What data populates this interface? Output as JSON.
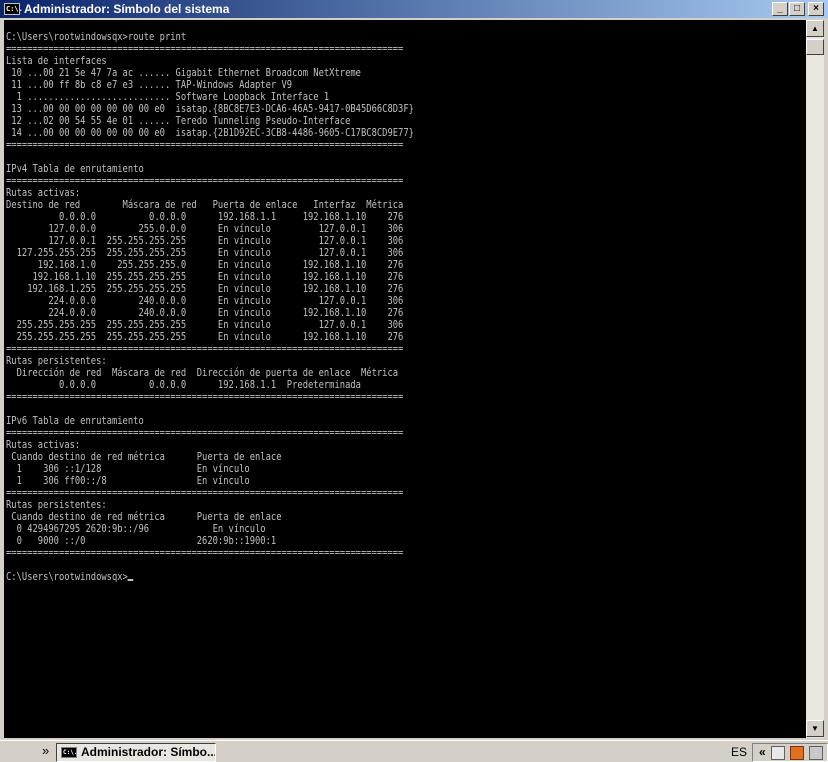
{
  "window": {
    "title": "Administrador: Símbolo del sistema",
    "icon_label": "C:\\."
  },
  "console": {
    "lines": [
      "C:\\Users\\rootwindowsqx>route print",
      "===========================================================================",
      "Lista de interfaces",
      " 10 ...00 21 5e 47 7a ac ...... Gigabit Ethernet Broadcom NetXtreme",
      " 11 ...00 ff 8b c8 e7 e3 ...... TAP-Windows Adapter V9",
      "  1 ........................... Software Loopback Interface 1",
      " 13 ...00 00 00 00 00 00 00 e0  isatap.{8BC8E7E3-DCA6-46A5-9417-0B45D66C8D3F}",
      " 12 ...02 00 54 55 4e 01 ...... Teredo Tunneling Pseudo-Interface",
      " 14 ...00 00 00 00 00 00 00 e0  isatap.{2B1D92EC-3CB8-4486-9605-C17BC8CD9E77}",
      "===========================================================================",
      "",
      "IPv4 Tabla de enrutamiento",
      "===========================================================================",
      "Rutas activas:",
      "Destino de red        Máscara de red   Puerta de enlace   Interfaz  Métrica",
      "          0.0.0.0          0.0.0.0      192.168.1.1     192.168.1.10    276",
      "        127.0.0.0        255.0.0.0      En vínculo         127.0.0.1    306",
      "        127.0.0.1  255.255.255.255      En vínculo         127.0.0.1    306",
      "  127.255.255.255  255.255.255.255      En vínculo         127.0.0.1    306",
      "      192.168.1.0    255.255.255.0      En vínculo      192.168.1.10    276",
      "     192.168.1.10  255.255.255.255      En vínculo      192.168.1.10    276",
      "    192.168.1.255  255.255.255.255      En vínculo      192.168.1.10    276",
      "        224.0.0.0        240.0.0.0      En vínculo         127.0.0.1    306",
      "        224.0.0.0        240.0.0.0      En vínculo      192.168.1.10    276",
      "  255.255.255.255  255.255.255.255      En vínculo         127.0.0.1    306",
      "  255.255.255.255  255.255.255.255      En vínculo      192.168.1.10    276",
      "===========================================================================",
      "Rutas persistentes:",
      "  Dirección de red  Máscara de red  Dirección de puerta de enlace  Métrica",
      "          0.0.0.0          0.0.0.0      192.168.1.1  Predeterminada",
      "===========================================================================",
      "",
      "IPv6 Tabla de enrutamiento",
      "===========================================================================",
      "Rutas activas:",
      " Cuando destino de red métrica      Puerta de enlace",
      "  1    306 ::1/128                  En vínculo",
      "  1    306 ff00::/8                 En vínculo",
      "===========================================================================",
      "Rutas persistentes:",
      " Cuando destino de red métrica      Puerta de enlace",
      "  0 4294967295 2620:9b::/96            En vínculo",
      "  0   9000 ::/0                     2620:9b::1900:1",
      "===========================================================================",
      "",
      "C:\\Users\\rootwindowsqx>"
    ]
  },
  "taskbar": {
    "overflow_chevron": "»",
    "task_label": "Administrador: Símbo...",
    "task_icon_label": "C:\\.",
    "language": "ES",
    "tray_chevron": "«"
  },
  "icons": {
    "minimize": "_",
    "maximize": "□",
    "close": "×",
    "scroll_up": "▲",
    "scroll_down": "▼"
  }
}
